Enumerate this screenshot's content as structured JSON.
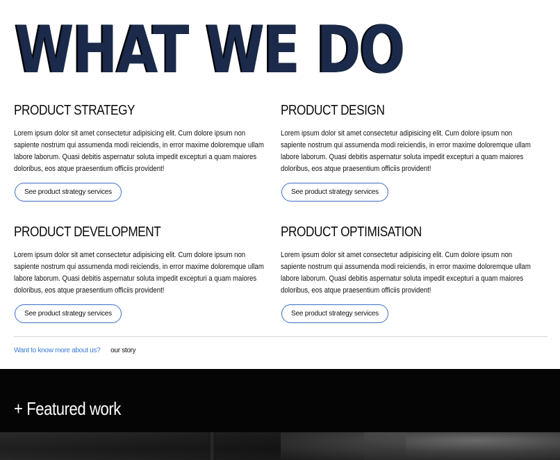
{
  "hero": {
    "title": "WHAT WE DO"
  },
  "services": [
    {
      "title": "PRODUCT STRATEGY",
      "body": "Lorem ipsum dolor sit amet consectetur adipisicing elit. Cum dolore ipsum non sapiente nostrum qui assumenda modi reiciendis, in error maxime doloremque ullam labore laborum. Quasi debitis aspernatur soluta impedit excepturi a quam maiores doloribus, eos atque praesentium officiis provident!",
      "button_label": "See product strategy services"
    },
    {
      "title": "PRODUCT DESIGN",
      "body": "Lorem ipsum dolor sit amet consectetur adipisicing elit. Cum dolore ipsum non sapiente nostrum qui assumenda modi reiciendis, in error maxime doloremque ullam labore laborum. Quasi debitis aspernatur soluta impedit excepturi a quam maiores doloribus, eos atque praesentium officiis provident!",
      "button_label": "See product strategy services"
    },
    {
      "title": "PRODUCT DEVELOPMENT",
      "body": "Lorem ipsum dolor sit amet consectetur adipisicing elit. Cum dolore ipsum non sapiente nostrum qui assumenda modi reiciendis, in error maxime doloremque ullam labore laborum. Quasi debitis aspernatur soluta impedit excepturi a quam maiores doloribus, eos atque praesentium officiis provident!",
      "button_label": "See product strategy services"
    },
    {
      "title": "PRODUCT OPTIMISATION",
      "body": "Lorem ipsum dolor sit amet consectetur adipisicing elit. Cum dolore ipsum non sapiente nostrum qui assumenda modi reiciendis, in error maxime doloremque ullam labore laborum. Quasi debitis aspernatur soluta impedit excepturi a quam maiores doloribus, eos atque praesentium officiis provident!",
      "button_label": "See product strategy services"
    }
  ],
  "more": {
    "prompt": "Want to know more about us?",
    "story_link": "our story"
  },
  "featured": {
    "heading": "+ Featured work"
  },
  "colors": {
    "accent": "#3b7ad6",
    "button_border": "#3a6fc4",
    "featured_bg": "#050505",
    "text": "#111111"
  }
}
